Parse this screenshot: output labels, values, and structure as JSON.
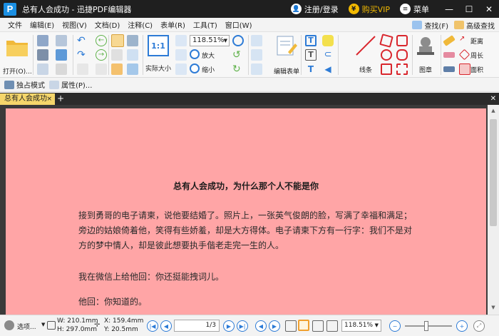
{
  "window": {
    "title": "总有人会成功 - 迅捷PDF编辑器",
    "logo_letter": "P",
    "login_label": "注册/登录",
    "vip_label": "购买VIP",
    "menu_label": "菜单"
  },
  "menubar": {
    "items": [
      "文件",
      "编辑(E)",
      "视图(V)",
      "文档(D)",
      "注释(C)",
      "表单(R)",
      "工具(T)",
      "窗口(W)"
    ],
    "find_label": "查找(F)",
    "advanced_find_label": "高级查找"
  },
  "ribbon": {
    "open_label": "打开(O)...",
    "actual_size_label": "实际大小",
    "actual_size_glyph": "1:1",
    "zoom_value": "118.51%",
    "zoom_in_label": "放大",
    "zoom_out_label": "缩小",
    "edit_form_label": "编辑表单",
    "lines_label": "线条",
    "stamp_label": "图章",
    "distance_label": "距离",
    "perimeter_label": "周长",
    "area_label": "面积"
  },
  "subbar": {
    "exclusive_mode_label": "独占模式",
    "properties_label": "属性(P)..."
  },
  "tabs": [
    {
      "label": "总有人会成功"
    }
  ],
  "document": {
    "title": "总有人会成功，为什么那个人不能是你",
    "paragraphs": [
      "接到勇哥的电子请柬，说他要结婚了。照片上，一张英气俊朗的脸，写满了幸福和满足；旁边的姑娘倚着他，笑得有些娇羞，却是大方得体。电子请柬下方有一行字：我们不是对方的梦中情人，却是彼此想要执手偕老走完一生的人。",
      "我在微信上给他回：你还挺能拽词儿。",
      "他回：你知道的。"
    ]
  },
  "statusbar": {
    "options_label": "选项...",
    "width_label": "W: 210.1mm",
    "height_label": "H: 297.0mm",
    "x_label": "X: 159.4mm",
    "y_label": "Y: 20.5mm",
    "current_page": "1",
    "total_pages": "3",
    "page_display": "1/3",
    "zoom_value": "118.51%"
  },
  "colors": {
    "page_background": "#ffa5a6",
    "titlebar": "#1f1f1f",
    "active_tab": "#f5d66b",
    "accent_blue": "#2d7bd6",
    "vip_gold": "#f2b900"
  }
}
